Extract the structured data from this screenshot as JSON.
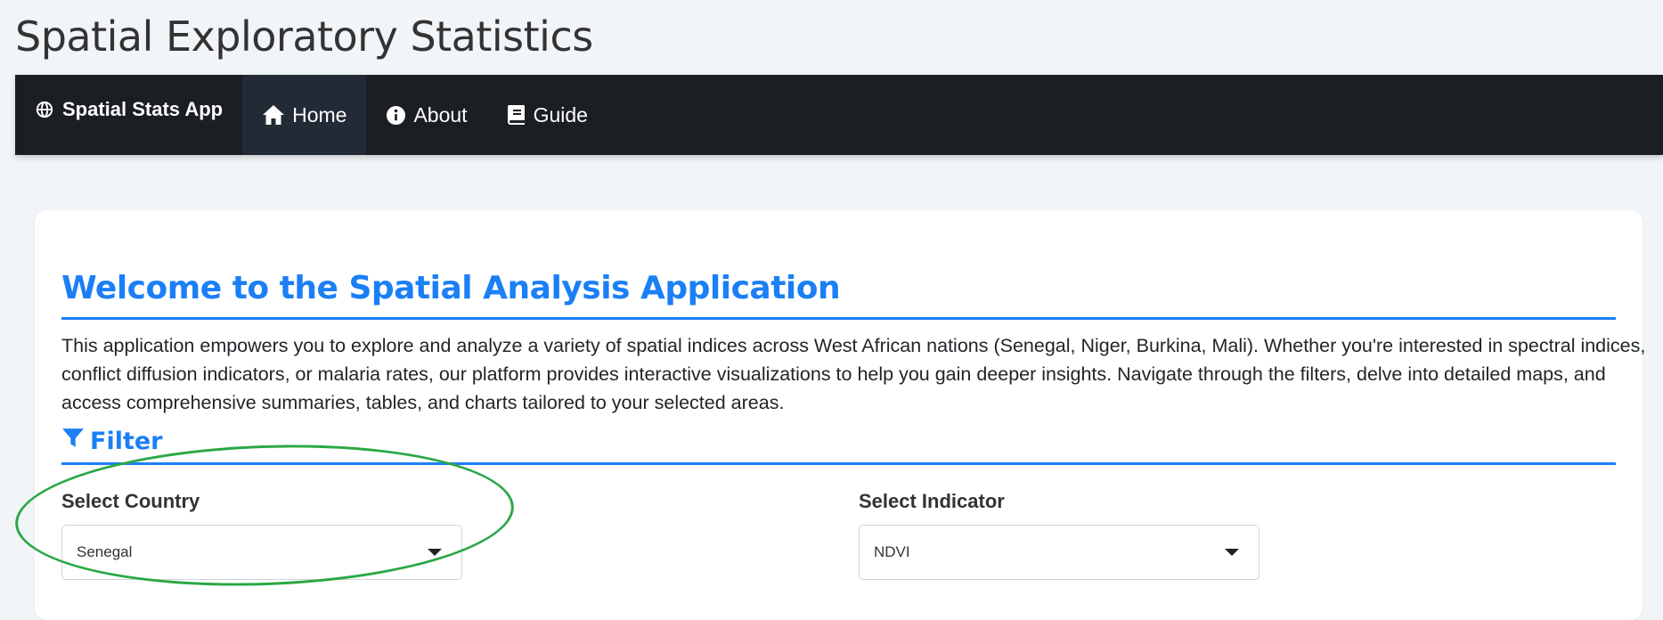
{
  "app": {
    "title": "Spatial Exploratory Statistics"
  },
  "navbar": {
    "brand": "Spatial Stats App",
    "brand_icon": "globe-icon",
    "items": [
      {
        "label": "Home",
        "icon": "home-icon",
        "active": true
      },
      {
        "label": "About",
        "icon": "info-circle-icon",
        "active": false
      },
      {
        "label": "Guide",
        "icon": "book-icon",
        "active": false
      }
    ]
  },
  "main": {
    "heading": "Welcome to the Spatial Analysis Application",
    "intro": "This application empowers you to explore and analyze a variety of spatial indices across West African nations (Senegal, Niger, Burkina, Mali). Whether you're interested in spectral indices, conflict diffusion indicators, or malaria rates, our platform provides interactive visualizations to help you gain deeper insights. Navigate through the filters, delve into detailed maps, and access comprehensive summaries, tables, and charts tailored to your selected areas.",
    "filter": {
      "title": "Filter",
      "icon": "filter-icon",
      "country_label": "Select Country",
      "country_value": "Senegal",
      "indicator_label": "Select Indicator",
      "indicator_value": "NDVI"
    }
  },
  "colors": {
    "accent": "#1b7ff5",
    "navbar_bg": "#1b1e22",
    "annotation": "#2aa845"
  }
}
